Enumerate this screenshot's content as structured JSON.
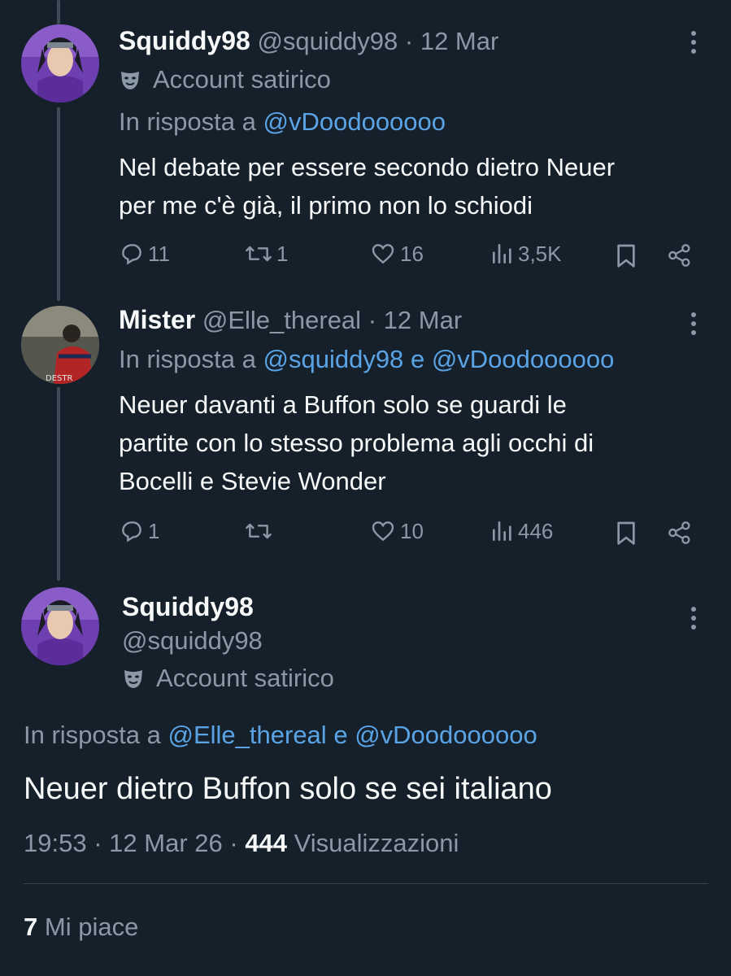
{
  "tweet1": {
    "name": "Squiddy98",
    "handle": "@squiddy98",
    "sep": "·",
    "date": "12 Mar",
    "badge_label": "Account satirico",
    "reply_prefix": "In risposta a",
    "reply_to": "@vDoodoooooo",
    "text_line1": "Nel debate per essere secondo dietro Neuer",
    "text_line2": "per me c'è già, il primo non lo schiodi",
    "replies": "11",
    "retweets": "1",
    "likes": "16",
    "views": "3,5K"
  },
  "tweet2": {
    "name": "Mister",
    "handle": "@Elle_thereal",
    "sep": "·",
    "date": "12 Mar",
    "reply_prefix": "In risposta a",
    "reply_to_1": "@squiddy98",
    "reply_and": "e",
    "reply_to_2": "@vDoodoooooo",
    "text_line1": "Neuer davanti a Buffon solo se guardi le",
    "text_line2": "partite con lo stesso problema agli occhi di",
    "text_line3": "Bocelli e Stevie Wonder",
    "replies": "1",
    "retweets": "",
    "likes": "10",
    "views": "446",
    "avatar_jersey": "DESTR"
  },
  "main": {
    "name": "Squiddy98",
    "handle": "@squiddy98",
    "badge_label": "Account satirico",
    "reply_prefix": "In risposta a",
    "reply_to_1": "@Elle_thereal",
    "reply_and": "e",
    "reply_to_2": "@vDoodoooooo",
    "text": "Neuer dietro Buffon solo se sei italiano",
    "time": "19:53",
    "sep": "·",
    "date": "12 Mar 26",
    "sep2": "·",
    "views_count": "444",
    "views_label": "Visualizzazioni",
    "likes_count": "7",
    "likes_label": "Mi piace"
  },
  "icons": {
    "mask": "theater-mask-icon",
    "more": "more-vertical-icon",
    "reply": "reply-icon",
    "retweet": "retweet-icon",
    "like": "heart-icon",
    "views": "analytics-icon",
    "bookmark": "bookmark-icon",
    "share": "share-icon"
  },
  "colors": {
    "background": "#15202b",
    "primary_text": "#f7f9f9",
    "secondary_text": "#8b98a5",
    "link": "#5aa4e6"
  }
}
